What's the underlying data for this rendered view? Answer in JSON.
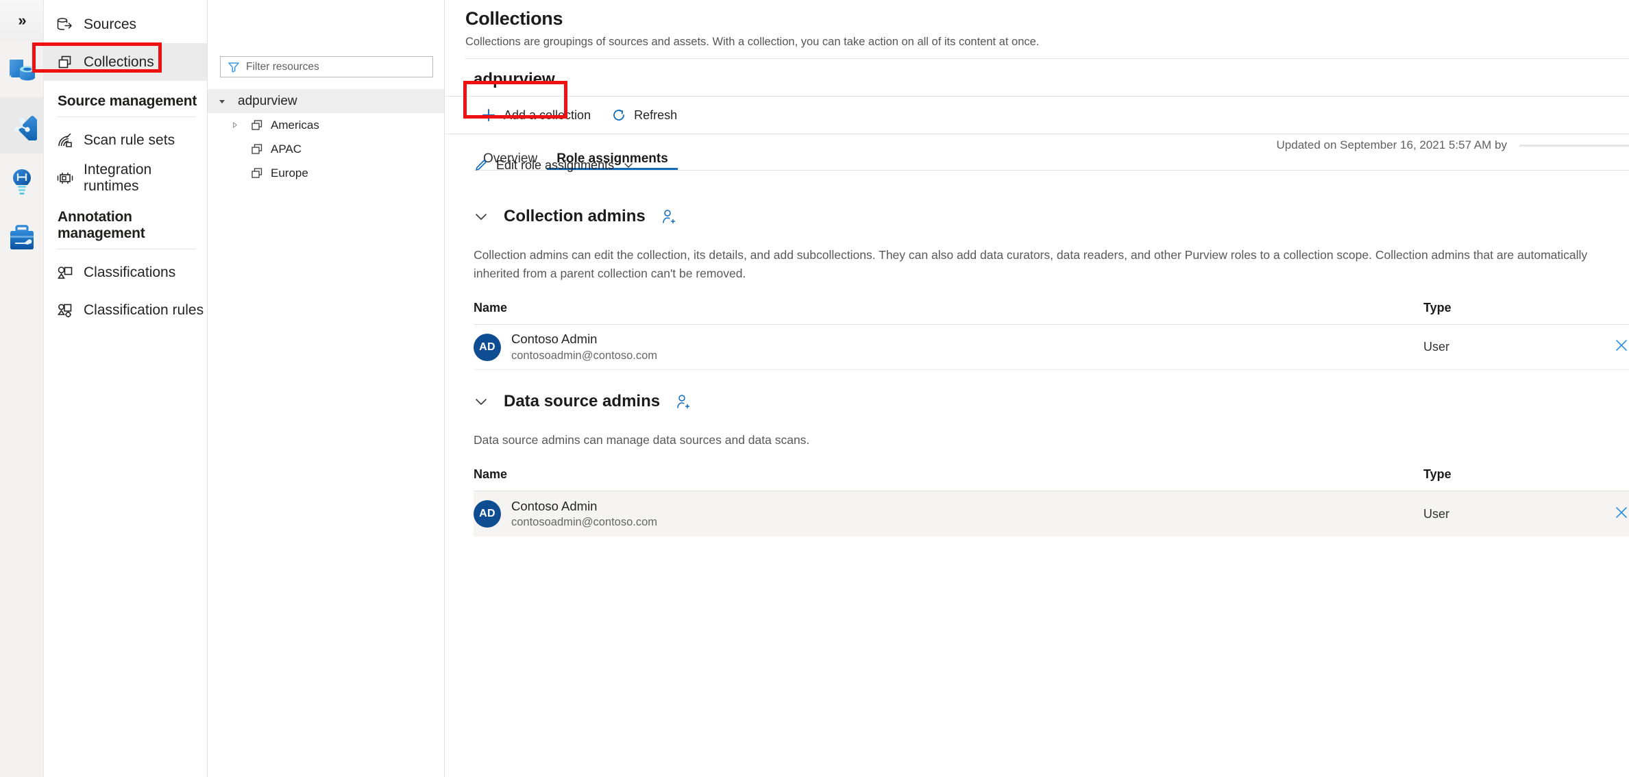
{
  "rail": {
    "expand_label": "»",
    "items": [
      {
        "name": "data-catalog-icon",
        "title": "Data catalog",
        "selected": false
      },
      {
        "name": "data-map-icon",
        "title": "Data map",
        "selected": true
      },
      {
        "name": "insights-icon",
        "title": "Insights",
        "selected": false
      },
      {
        "name": "management-icon",
        "title": "Management",
        "selected": false
      }
    ]
  },
  "sidebar": {
    "items": [
      {
        "label": "Sources",
        "icon": "sources-icon",
        "active": false
      },
      {
        "label": "Collections",
        "icon": "collections-icon",
        "active": true
      }
    ],
    "groups": [
      {
        "header": "Source management",
        "items": [
          {
            "label": "Scan rule sets",
            "icon": "scan-rule-sets-icon"
          },
          {
            "label": "Integration runtimes",
            "icon": "integration-runtimes-icon"
          }
        ]
      },
      {
        "header": "Annotation management",
        "items": [
          {
            "label": "Classifications",
            "icon": "classifications-icon"
          },
          {
            "label": "Classification rules",
            "icon": "classification-rules-icon"
          }
        ]
      }
    ]
  },
  "page": {
    "title": "Collections",
    "subtitle": "Collections are groupings of sources and assets. With a collection, you can take action on all of its content at once."
  },
  "filter": {
    "placeholder": "Filter resources",
    "icon": "filter-funnel-icon"
  },
  "tree": {
    "root": {
      "label": "adpurview",
      "expanded": true,
      "selected": true
    },
    "children": [
      {
        "label": "Americas",
        "has_children": true,
        "expanded": false
      },
      {
        "label": "APAC",
        "has_children": false,
        "expanded": false
      },
      {
        "label": "Europe",
        "has_children": false,
        "expanded": false
      }
    ]
  },
  "detail": {
    "title": "adpurview",
    "commands": [
      {
        "label": "Add a collection",
        "icon": "plus-icon"
      },
      {
        "label": "Refresh",
        "icon": "refresh-icon"
      }
    ],
    "tabs": [
      {
        "label": "Overview",
        "selected": false
      },
      {
        "label": "Role assignments",
        "selected": true
      }
    ],
    "edit_role_assignments": "Edit role assignments",
    "updated_text": "Updated on September 16, 2021 5:57 AM by"
  },
  "sections": [
    {
      "title": "Collection admins",
      "description": "Collection admins can edit the collection, its details, and add subcollections. They can also add data curators, data readers, and other Purview roles to a collection scope. Collection admins that are automatically inherited from a parent collection can't be removed.",
      "columns": {
        "name": "Name",
        "type": "Type"
      },
      "rows": [
        {
          "initials": "AD",
          "name": "Contoso Admin",
          "email": "contosoadmin@contoso.com",
          "type": "User",
          "highlighted": false
        }
      ]
    },
    {
      "title": "Data source admins",
      "description": "Data source admins can manage data sources and data scans.",
      "columns": {
        "name": "Name",
        "type": "Type"
      },
      "rows": [
        {
          "initials": "AD",
          "name": "Contoso Admin",
          "email": "contosoadmin@contoso.com",
          "type": "User",
          "highlighted": true
        }
      ]
    }
  ],
  "annotations": {
    "highlight_color": "#ee1111",
    "boxes": [
      {
        "name": "collections-nav-highlight"
      },
      {
        "name": "add-a-collection-highlight"
      }
    ]
  },
  "colors": {
    "accent": "#0f6cbd",
    "avatar": "#0f4d92",
    "selected_row": "#eeeeee"
  }
}
